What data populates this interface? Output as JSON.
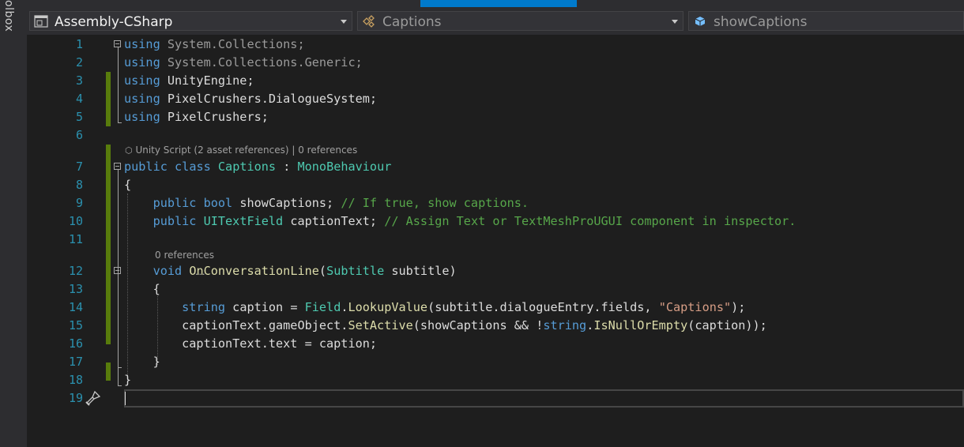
{
  "toolbox_label": "olbox",
  "navbar": {
    "project": "Assembly-CSharp",
    "class": "Captions",
    "member": "showCaptions"
  },
  "lenses": {
    "class_lens": "Unity Script (2 asset references) | 0 references",
    "method_lens": "0 references"
  },
  "line_numbers": [
    "1",
    "2",
    "3",
    "4",
    "5",
    "6",
    "7",
    "8",
    "9",
    "10",
    "11",
    "12",
    "13",
    "14",
    "15",
    "16",
    "17",
    "18",
    "19"
  ],
  "code_lines": [
    [
      {
        "t": "using",
        "c": "kw"
      },
      {
        "t": " System.Collections;",
        "c": "gy"
      }
    ],
    [
      {
        "t": "using",
        "c": "kw"
      },
      {
        "t": " System.Collections.Generic;",
        "c": "gy"
      }
    ],
    [
      {
        "t": "using",
        "c": "kw"
      },
      {
        "t": " UnityEngine;",
        "c": ""
      }
    ],
    [
      {
        "t": "using",
        "c": "kw"
      },
      {
        "t": " PixelCrushers.DialogueSystem;",
        "c": ""
      }
    ],
    [
      {
        "t": "using",
        "c": "kw"
      },
      {
        "t": " PixelCrushers;",
        "c": ""
      }
    ],
    [],
    [
      {
        "t": "public",
        "c": "kw"
      },
      {
        "t": " ",
        "c": ""
      },
      {
        "t": "class",
        "c": "kw"
      },
      {
        "t": " ",
        "c": ""
      },
      {
        "t": "Captions",
        "c": "ty"
      },
      {
        "t": " : ",
        "c": ""
      },
      {
        "t": "MonoBehaviour",
        "c": "ty"
      }
    ],
    [
      {
        "t": "{",
        "c": ""
      }
    ],
    [
      {
        "t": "    ",
        "c": ""
      },
      {
        "t": "public",
        "c": "kw"
      },
      {
        "t": " ",
        "c": ""
      },
      {
        "t": "bool",
        "c": "kw"
      },
      {
        "t": " showCaptions; ",
        "c": ""
      },
      {
        "t": "// If true, show captions.",
        "c": "cm"
      }
    ],
    [
      {
        "t": "    ",
        "c": ""
      },
      {
        "t": "public",
        "c": "kw"
      },
      {
        "t": " ",
        "c": ""
      },
      {
        "t": "UITextField",
        "c": "ty"
      },
      {
        "t": " captionText; ",
        "c": ""
      },
      {
        "t": "// Assign Text or TextMeshProUGUI component in inspector.",
        "c": "cm"
      }
    ],
    [],
    [
      {
        "t": "    ",
        "c": ""
      },
      {
        "t": "void",
        "c": "kw"
      },
      {
        "t": " ",
        "c": ""
      },
      {
        "t": "OnConversationLine",
        "c": "me"
      },
      {
        "t": "(",
        "c": ""
      },
      {
        "t": "Subtitle",
        "c": "ty"
      },
      {
        "t": " subtitle)",
        "c": ""
      }
    ],
    [
      {
        "t": "    {",
        "c": ""
      }
    ],
    [
      {
        "t": "        ",
        "c": ""
      },
      {
        "t": "string",
        "c": "kw"
      },
      {
        "t": " caption = ",
        "c": ""
      },
      {
        "t": "Field",
        "c": "ty"
      },
      {
        "t": ".",
        "c": ""
      },
      {
        "t": "LookupValue",
        "c": "me"
      },
      {
        "t": "(subtitle.dialogueEntry.fields, ",
        "c": ""
      },
      {
        "t": "\"Captions\"",
        "c": "st"
      },
      {
        "t": ");",
        "c": ""
      }
    ],
    [
      {
        "t": "        captionText.gameObject.",
        "c": ""
      },
      {
        "t": "SetActive",
        "c": "me"
      },
      {
        "t": "(showCaptions && !",
        "c": ""
      },
      {
        "t": "string",
        "c": "kw"
      },
      {
        "t": ".",
        "c": ""
      },
      {
        "t": "IsNullOrEmpty",
        "c": "me"
      },
      {
        "t": "(caption));",
        "c": ""
      }
    ],
    [
      {
        "t": "        captionText.text = caption;",
        "c": ""
      }
    ],
    [
      {
        "t": "    }",
        "c": ""
      }
    ],
    [
      {
        "t": "}",
        "c": ""
      }
    ],
    []
  ]
}
